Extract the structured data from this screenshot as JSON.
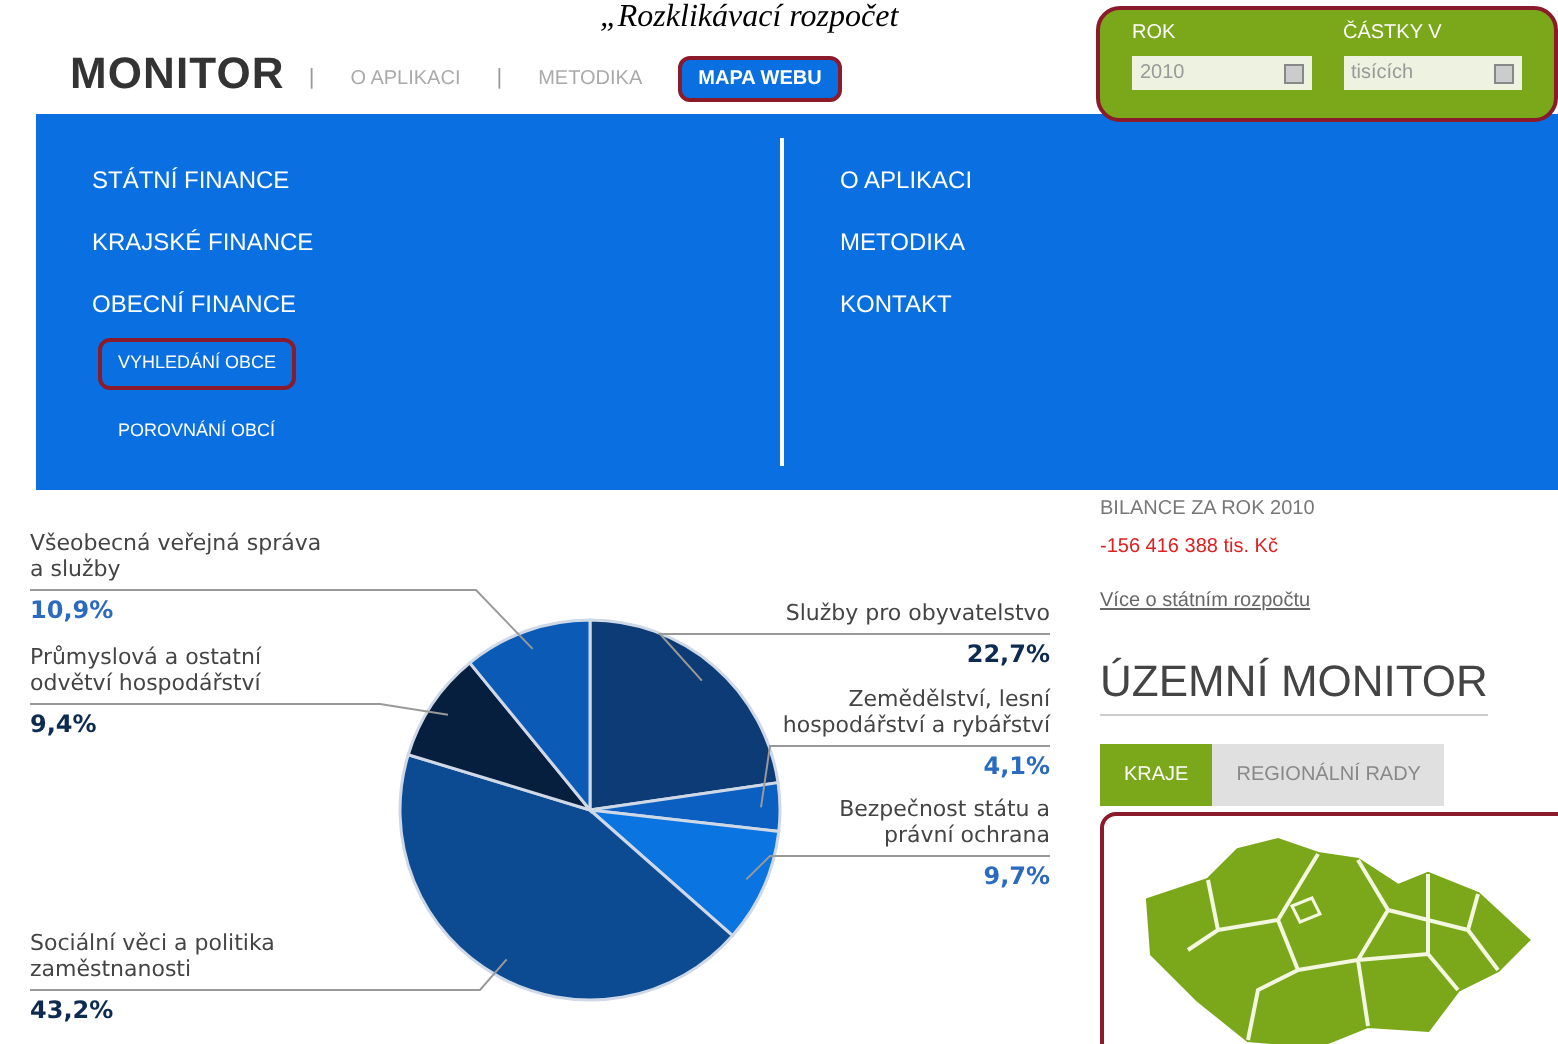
{
  "caption": "„Rozklikávací rozpočet",
  "header": {
    "logo": "MONITOR",
    "separator": "|",
    "nav": [
      {
        "label": "O APLIKACI",
        "selected": false,
        "highlighted": false
      },
      {
        "label": "METODIKA",
        "selected": false,
        "highlighted": false
      },
      {
        "label": "MAPA WEBU",
        "selected": true,
        "highlighted": true
      }
    ]
  },
  "filters": {
    "highlighted": true,
    "fields": [
      {
        "label": "ROK",
        "value": "2010"
      },
      {
        "label": "ČÁSTKY V",
        "value": "tisících"
      }
    ]
  },
  "menu": {
    "left": [
      {
        "label": "STÁTNÍ FINANCE"
      },
      {
        "label": "KRAJSKÉ FINANCE"
      },
      {
        "label": "OBECNÍ FINANCE",
        "children": [
          {
            "label": "VYHLEDÁNÍ OBCE",
            "highlighted": true
          },
          {
            "label": "POROVNÁNÍ OBCÍ",
            "highlighted": false
          }
        ]
      }
    ],
    "right": [
      {
        "label": "O APLIKACI"
      },
      {
        "label": "METODIKA"
      },
      {
        "label": "KONTAKT"
      }
    ]
  },
  "chart_data": {
    "type": "pie",
    "data_labels": true,
    "categories": [
      "Služby pro obyvatelstvo",
      "Zemědělství, lesní hospodářství a rybářství",
      "Bezpečnost státu a právní ochrana",
      "Sociální věci a politika zaměstnanosti",
      "Průmyslová a ostatní odvětví hospodářství",
      "Všeobecná veřejná správa a služby"
    ],
    "values": [
      22.7,
      4.1,
      9.7,
      43.2,
      9.4,
      10.9
    ],
    "value_labels": [
      "22,7%",
      "4,1%",
      "9,7%",
      "43,2%",
      "9,4%",
      "10,9%"
    ],
    "colors": [
      "#0d3b75",
      "#0a5fc0",
      "#0a74e0",
      "#0c4a92",
      "#061f3f",
      "#0b5ab5"
    ]
  },
  "balance": {
    "title": "BILANCE ZA ROK 2010",
    "amount": "-156 416 388 tis. Kč",
    "link": "Více o státním rozpočtu"
  },
  "territorial": {
    "title": "ÚZEMNÍ MONITOR",
    "tabs": [
      {
        "label": "KRAJE",
        "selected": true
      },
      {
        "label": "REGIONÁLNÍ RADY",
        "selected": false
      }
    ],
    "map_highlighted": true
  }
}
